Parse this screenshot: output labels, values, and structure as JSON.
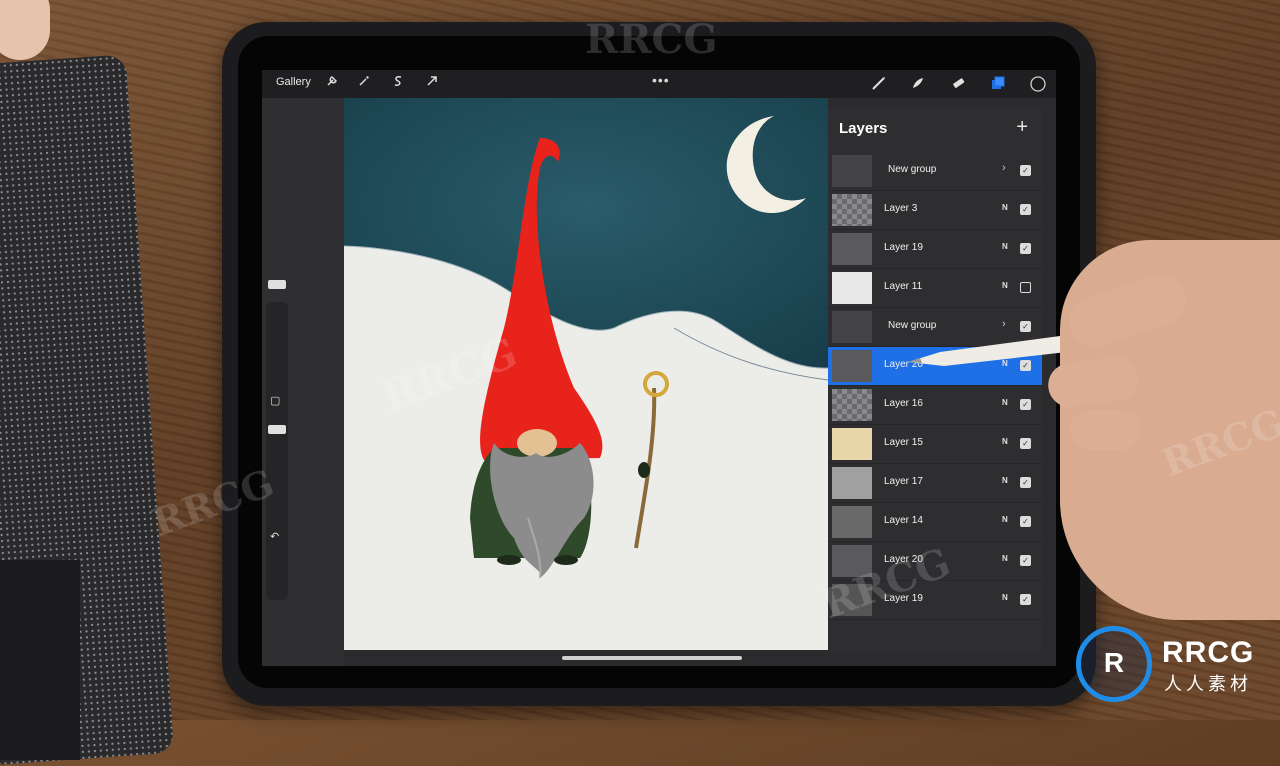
{
  "topbar": {
    "gallery_label": "Gallery",
    "more_label": "•••",
    "icons": [
      "wrench-icon",
      "magic-wand-icon",
      "selection-icon",
      "transform-arrow-icon",
      "brush-icon",
      "smudge-icon",
      "eraser-icon",
      "layers-icon",
      "color-swatch-icon"
    ]
  },
  "sidebar": {
    "undo_label": "↶"
  },
  "layers_panel": {
    "title": "Layers",
    "add_label": "+",
    "items": [
      {
        "name": "New group",
        "mode": "",
        "visible": true,
        "group": true,
        "selected": false
      },
      {
        "name": "Layer 3",
        "mode": "N",
        "visible": true,
        "group": false,
        "selected": false
      },
      {
        "name": "Layer 19",
        "mode": "N",
        "visible": true,
        "group": false,
        "selected": false
      },
      {
        "name": "Layer 11",
        "mode": "N",
        "visible": false,
        "group": false,
        "selected": false
      },
      {
        "name": "New group",
        "mode": "",
        "visible": true,
        "group": true,
        "selected": false
      },
      {
        "name": "Layer 20",
        "mode": "N",
        "visible": true,
        "group": false,
        "selected": true
      },
      {
        "name": "Layer 16",
        "mode": "N",
        "visible": true,
        "group": false,
        "selected": false
      },
      {
        "name": "Layer 15",
        "mode": "N",
        "visible": true,
        "group": false,
        "selected": false
      },
      {
        "name": "Layer 17",
        "mode": "N",
        "visible": true,
        "group": false,
        "selected": false
      },
      {
        "name": "Layer 14",
        "mode": "N",
        "visible": true,
        "group": false,
        "selected": false
      },
      {
        "name": "Layer 20",
        "mode": "N",
        "visible": true,
        "group": false,
        "selected": false
      },
      {
        "name": "Layer 19",
        "mode": "N",
        "visible": true,
        "group": false,
        "selected": false
      }
    ]
  },
  "colors": {
    "accent": "#1f6fe6",
    "sky": "#1d4a57",
    "hat": "#e8231c",
    "snow": "#ecece8"
  },
  "watermark": {
    "text": "RRCG",
    "logo_letters": "R",
    "logo_name": "RRCG",
    "logo_sub": "人人素材"
  }
}
